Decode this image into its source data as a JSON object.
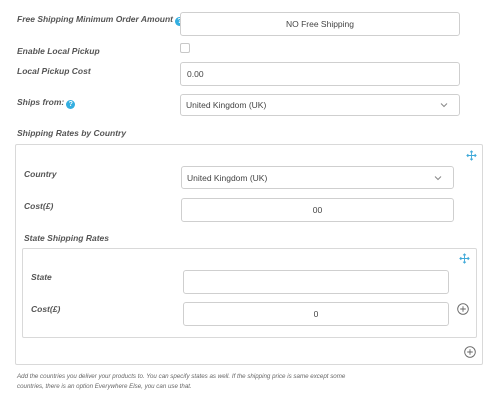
{
  "free_shipping": {
    "label": "Free Shipping Minimum Order Amount",
    "value": "NO Free Shipping"
  },
  "local_pickup": {
    "enable_label": "Enable Local Pickup",
    "enabled": false,
    "cost_label": "Local Pickup Cost",
    "cost_value": "0.00"
  },
  "ships_from": {
    "label": "Ships from:",
    "value": "United Kingdom (UK)"
  },
  "shipping_rates": {
    "section_label": "Shipping Rates by Country",
    "country_label": "Country",
    "country_value": "United Kingdom (UK)",
    "cost_label": "Cost(£)",
    "cost_value": "00",
    "state_section_label": "State Shipping Rates",
    "state_label": "State",
    "state_value": "",
    "state_cost_label": "Cost(£)",
    "state_cost_value": "0"
  },
  "help_text": {
    "line1": "Add the countries you deliver your products to. You can specify states as well. If the shipping price is same except some",
    "line2": "countries, there is an option Everywhere Else, you can use that."
  },
  "colors": {
    "help_icon": "#33aee0",
    "move_icon": "#3fa9d9"
  }
}
